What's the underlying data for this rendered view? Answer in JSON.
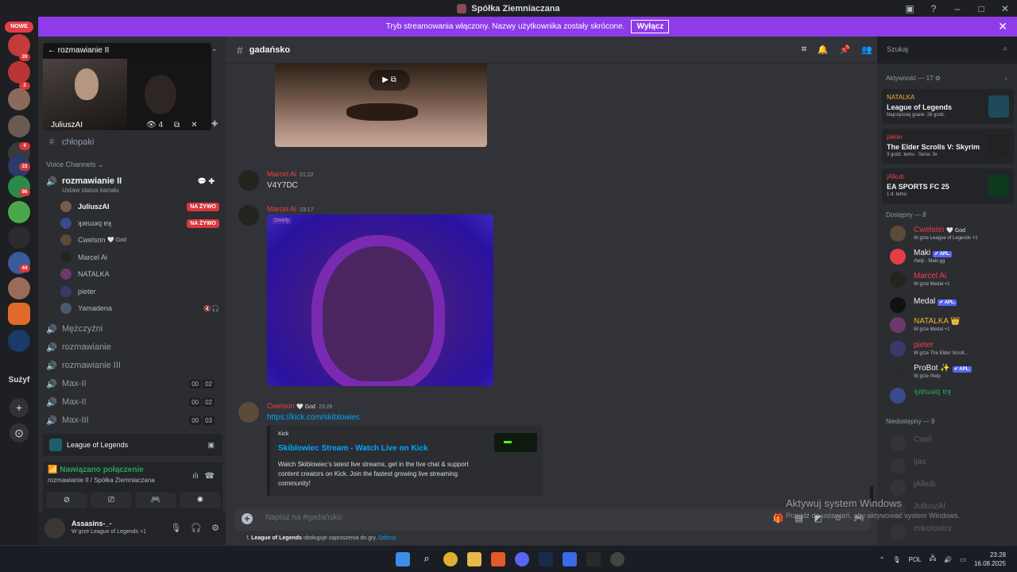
{
  "window": {
    "title": "Spółka Ziemniaczana"
  },
  "banner": {
    "text": "Tryb streamowania włączony. Nazwy użytkownika zostały skrócone.",
    "button": "Wyłącz"
  },
  "guilds": {
    "new_label": "NOWE",
    "badges": [
      "20",
      "2",
      "4",
      "23",
      "86",
      "44"
    ],
    "server_name": "Sużyf"
  },
  "pip": {
    "channel": "rozmawianie II",
    "streamer": "JuliuszAI",
    "viewers": "4"
  },
  "channels": {
    "text": [
      {
        "name": "chłopaki"
      }
    ],
    "voice_category": "Voice Channels",
    "active_voice": {
      "name": "rozmawianie II",
      "status": "Ustaw status kanału"
    },
    "voice_users": [
      {
        "name": "JuliuszAI",
        "live": "NA ŻYWO"
      },
      {
        "name": "ʞɹɐɯǝq ɐʞ",
        "live": "NA ŻYWO"
      },
      {
        "name": "Cwelson",
        "tag": "🤍 God"
      },
      {
        "name": "Marcel Ai"
      },
      {
        "name": "NATALKA"
      },
      {
        "name": "pieter"
      },
      {
        "name": "Yamadena"
      }
    ],
    "other_voice": [
      {
        "name": "Mężczyźni"
      },
      {
        "name": "rozmawianie"
      },
      {
        "name": "rozmawianie III"
      },
      {
        "name": "Max-II",
        "counts": [
          "00",
          "02"
        ]
      },
      {
        "name": "Max-II",
        "counts": [
          "00",
          "02"
        ]
      },
      {
        "name": "Max-III",
        "counts": [
          "00",
          "03"
        ]
      }
    ]
  },
  "game_activity": "League of Legends",
  "connection": {
    "status": "Nawiązano połączenie",
    "location": "rozmawianie II / Spółka Ziemniaczana"
  },
  "user": {
    "name": "Assasins-_-",
    "status": "W grze League of Legends +1"
  },
  "chat": {
    "channel": "gadańsko",
    "search_placeholder": "Szukaj",
    "messages": [
      {
        "author": "Marcel Ai",
        "time": "21:22",
        "text": "V4Y7DC"
      },
      {
        "author": "Marcel Ai",
        "time": "23:17",
        "image_tag": "Ominfy"
      },
      {
        "author": "Cwelson",
        "badge": "🤍 God",
        "time": "23:26",
        "link": "https://kick.com/skiblowiec"
      }
    ],
    "embed": {
      "provider": "Kick",
      "title": "Skiblowiec Stream - Watch Live on Kick",
      "description": "Watch Skiblowiec's latest live streams, get in the live chat & support content creators on Kick. Join the fastest growing live streaming community!"
    },
    "input_placeholder": "Napisz na #gadańsko",
    "invite_hint_game": "League of Legends",
    "invite_hint_text": "obsługuje zaproszenia do gry.",
    "invite_hint_action": "Odrzuć"
  },
  "members": {
    "activity_header": "Aktywność — 17",
    "activities": [
      {
        "user": "NATALKA",
        "game": "League of Legends",
        "detail": "Najczęściej grane: 26 godz."
      },
      {
        "user": "pieter",
        "game": "The Elder Scrolls V: Skyrim",
        "detail": "3 godz. temu · Seria: 3x"
      },
      {
        "user": "jAlkub",
        "game": "EA SPORTS FC 25",
        "detail": "1 d. temu"
      }
    ],
    "online_header": "Dostępny — 8",
    "online": [
      {
        "name": "Cwelson",
        "tag": "🤍 God",
        "sub": "W grze League of Legends +1",
        "color": "#f23f43"
      },
      {
        "name": "Maki",
        "tag": "✔ APL.",
        "sub": "/help · Maki.gg",
        "color": "#dbdee1"
      },
      {
        "name": "Marcel Ai",
        "sub": "W grze Medal +1",
        "color": "#f23f43"
      },
      {
        "name": "Medal",
        "tag": "✔ APL.",
        "sub": "",
        "color": "#dbdee1"
      },
      {
        "name": "NATALKA",
        "tag": "👑",
        "sub": "W grze Medal +1",
        "color": "#f0b232"
      },
      {
        "name": "pieter",
        "sub": "W grze The Elder Scroll...",
        "color": "#f23f43"
      },
      {
        "name": "ProBot ✨",
        "tag": "✔ APL.",
        "sub": "W grze /help",
        "color": "#dbdee1"
      },
      {
        "name": "ʞɹɐɯǝq ɐʞ",
        "sub": "",
        "color": "#23a55a"
      }
    ],
    "offline_header": "Niedostępny — 9",
    "offline": [
      {
        "name": "Cwel"
      },
      {
        "name": "ijas"
      },
      {
        "name": "jAlkub"
      },
      {
        "name": "JuliuszAI"
      },
      {
        "name": "mikolowicz"
      }
    ]
  },
  "windows_watermark": {
    "line1": "Aktywuj system Windows",
    "line2": "Przejdź do ustawień, aby aktywować system Windows."
  },
  "taskbar": {
    "lang": "POL",
    "time": "23:28",
    "date": "16.08.2025"
  }
}
